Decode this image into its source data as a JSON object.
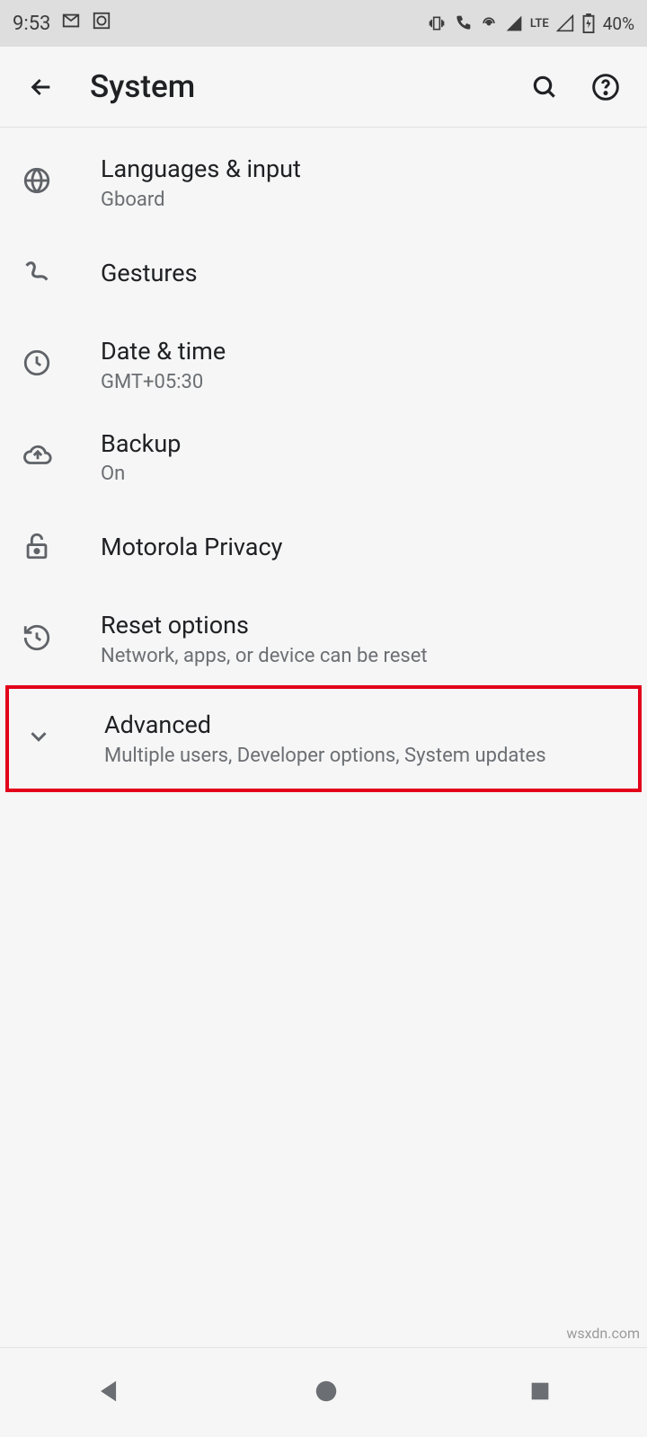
{
  "status": {
    "time": "9:53",
    "battery_text": "40%",
    "network_label": "LTE"
  },
  "toolbar": {
    "title": "System"
  },
  "items": [
    {
      "title": "Languages & input",
      "subtitle": "Gboard",
      "icon": "globe"
    },
    {
      "title": "Gestures",
      "subtitle": "",
      "icon": "gesture"
    },
    {
      "title": "Date & time",
      "subtitle": "GMT+05:30",
      "icon": "clock"
    },
    {
      "title": "Backup",
      "subtitle": "On",
      "icon": "cloud-upload"
    },
    {
      "title": "Motorola Privacy",
      "subtitle": "",
      "icon": "unlock"
    },
    {
      "title": "Reset options",
      "subtitle": "Network, apps, or device can be reset",
      "icon": "restore"
    },
    {
      "title": "Advanced",
      "subtitle": "Multiple users, Developer options, System updates",
      "icon": "chevron-down"
    }
  ],
  "watermark": "wsxdn.com"
}
